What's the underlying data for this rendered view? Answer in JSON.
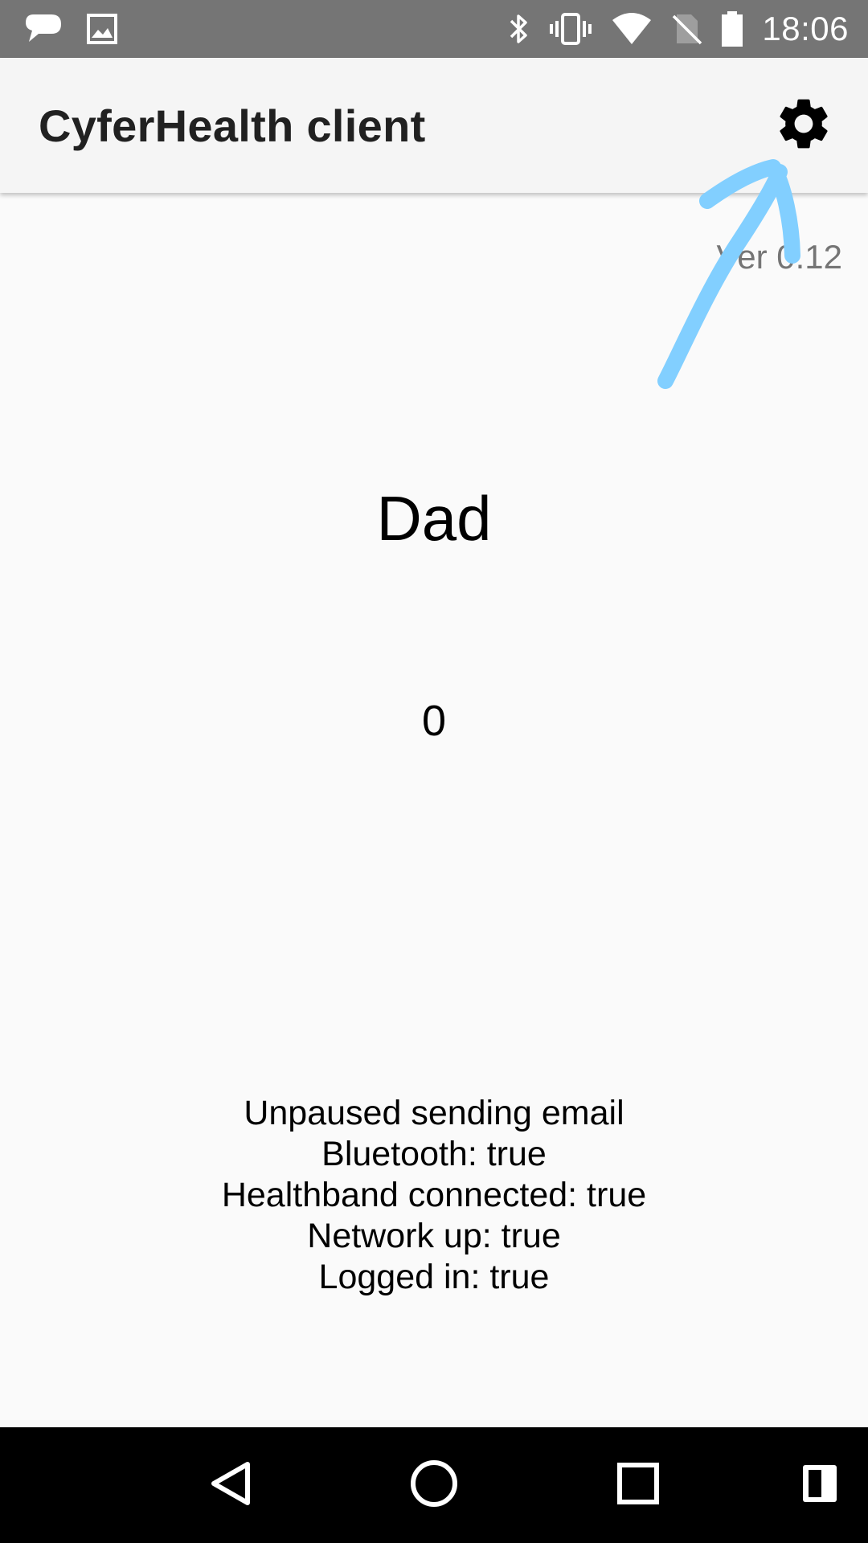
{
  "status_bar": {
    "time": "18:06",
    "left_icons": [
      "messenger-icon",
      "image-icon"
    ],
    "right_icons": [
      "bluetooth-icon",
      "vibrate-icon",
      "wifi-icon",
      "no-sim-icon",
      "battery-icon"
    ]
  },
  "app_bar": {
    "title": "CyferHealth client",
    "action_icon": "gear-icon"
  },
  "content": {
    "version": "Ver 0.12",
    "profile_name": "Dad",
    "counter": "0",
    "status_lines": [
      "Unpaused sending email",
      "Bluetooth: true",
      "Healthband connected: true",
      "Network up: true",
      "Logged in: true"
    ]
  },
  "annotation": {
    "color": "#82cfff",
    "points_to": "gear-icon"
  },
  "nav_bar": {
    "buttons": [
      "back-icon",
      "home-icon",
      "recents-icon",
      "split-screen-icon"
    ]
  }
}
